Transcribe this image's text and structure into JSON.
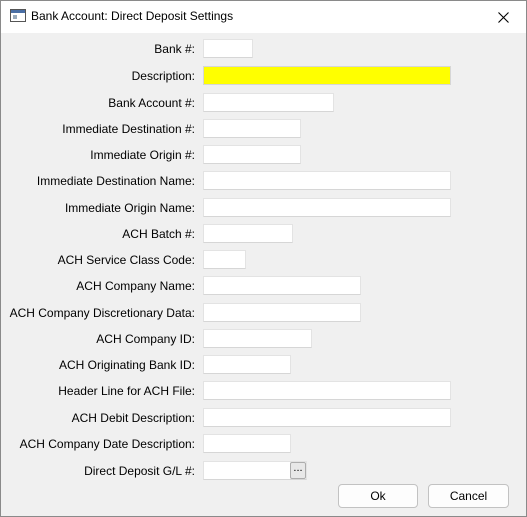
{
  "window": {
    "title": "Bank Account: Direct Deposit Settings"
  },
  "fields": [
    {
      "label": "Bank #:",
      "value": ""
    },
    {
      "label": "Description:",
      "value": ""
    },
    {
      "label": "Bank Account #:",
      "value": ""
    },
    {
      "label": "Immediate Destination #:",
      "value": ""
    },
    {
      "label": "Immediate Origin #:",
      "value": ""
    },
    {
      "label": "Immediate Destination Name:",
      "value": ""
    },
    {
      "label": "Immediate Origin Name:",
      "value": ""
    },
    {
      "label": "ACH Batch #:",
      "value": ""
    },
    {
      "label": "ACH Service Class Code:",
      "value": ""
    },
    {
      "label": "ACH Company Name:",
      "value": ""
    },
    {
      "label": "ACH Company Discretionary Data:",
      "value": ""
    },
    {
      "label": "ACH Company ID:",
      "value": ""
    },
    {
      "label": "ACH Originating Bank ID:",
      "value": ""
    },
    {
      "label": "Header Line for ACH File:",
      "value": ""
    },
    {
      "label": "ACH Debit Description:",
      "value": ""
    },
    {
      "label": "ACH Company Date Description:",
      "value": ""
    },
    {
      "label": "Direct Deposit G/L #:",
      "value": ""
    }
  ],
  "browse_button_label": "...",
  "buttons": {
    "ok_label": "Ok",
    "cancel_label": "Cancel"
  },
  "colors": {
    "highlight_field": "#ffff00",
    "background": "#f0f0f0"
  },
  "icons": {
    "app": "window-app-icon",
    "close": "close-icon"
  }
}
